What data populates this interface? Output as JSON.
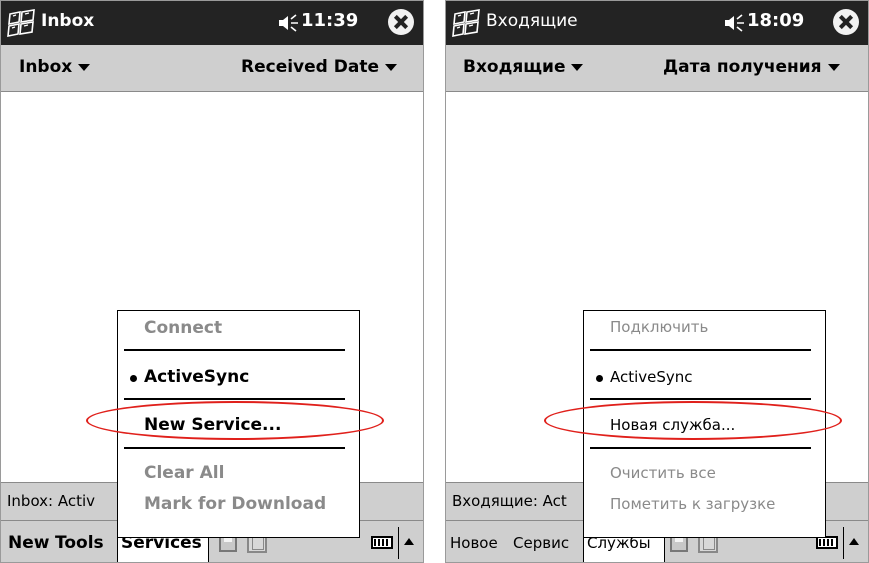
{
  "screens": [
    {
      "title": "Inbox",
      "time": "11:39",
      "nav": {
        "folder": "Inbox",
        "sort": "Received Date"
      },
      "status": "Inbox: Activ",
      "menubar": {
        "new_label": "New",
        "tools_label": "Tools",
        "services_label": "Services"
      },
      "popup": {
        "connect": "Connect",
        "activesync": "ActiveSync",
        "new_service": "New Service...",
        "clear_all": "Clear All",
        "mark_download": "Mark for Download"
      }
    },
    {
      "title": "Входящие",
      "time": "18:09",
      "nav": {
        "folder": "Входящие",
        "sort": "Дата получения"
      },
      "status": "Входящие: Act",
      "menubar": {
        "new_label": "Новое",
        "tools_label": "Сервис",
        "services_label": "Службы"
      },
      "popup": {
        "connect": "Подключить",
        "activesync": "ActiveSync",
        "new_service": "Новая служба...",
        "clear_all": "Очистить все",
        "mark_download": "Пометить к загрузке"
      }
    }
  ],
  "colors": {
    "titlebar": "#232323",
    "bar": "#cfcfcf",
    "highlight": "#e0201b",
    "disabled_text": "#8a8a8a"
  },
  "icons": [
    "windows-flag-icon",
    "speaker-icon",
    "close-icon",
    "dropdown-arrow-icon",
    "sync-icon",
    "keyboard-icon",
    "sip-arrow-icon"
  ]
}
